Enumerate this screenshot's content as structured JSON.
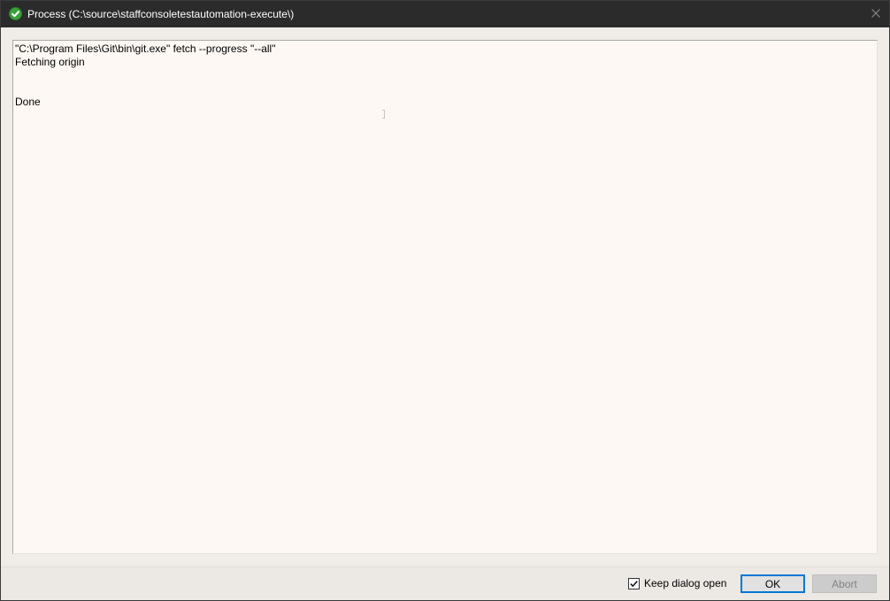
{
  "window": {
    "title": "Process (C:\\source\\staffconsoletestautomation-execute\\)",
    "title_icon": "success-check-icon",
    "close_icon": "close-icon"
  },
  "output": {
    "lines": [
      "\"C:\\Program Files\\Git\\bin\\git.exe\" fetch --progress \"--all\"",
      "Fetching origin",
      "",
      "Done"
    ]
  },
  "footer": {
    "keep_open_label": "Keep dialog open",
    "keep_open_checked": true,
    "ok_label": "OK",
    "abort_label": "Abort",
    "abort_enabled": false
  },
  "colors": {
    "titlebar": "#2b2b2b",
    "output_background": "#fdf8f3",
    "accent": "#0078d7",
    "success": "#3aa13a"
  }
}
